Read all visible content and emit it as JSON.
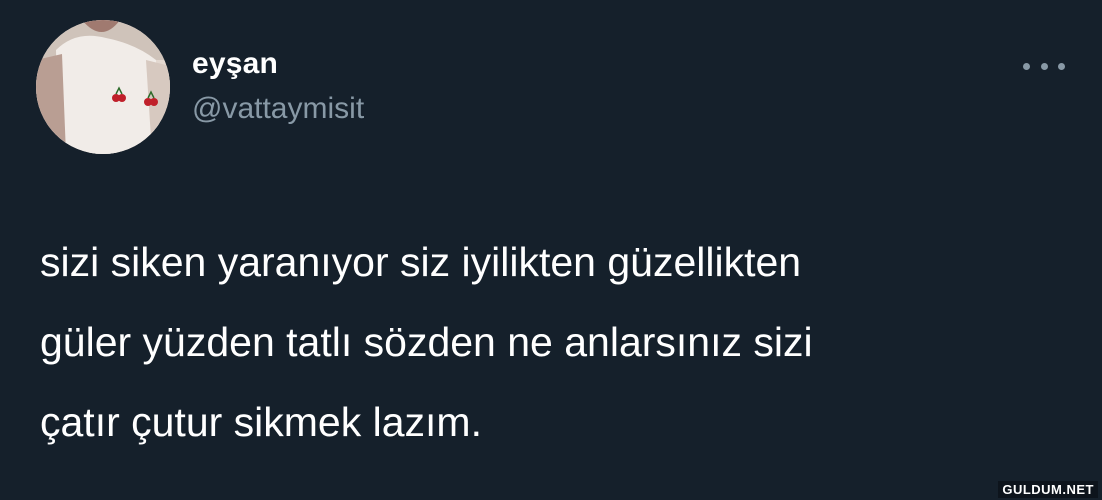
{
  "tweet": {
    "author": {
      "display_name": "eyşan",
      "handle": "@vattaymisit"
    },
    "text": "sizi siken yaranıyor siz iyilikten güzellikten\ngüler yüzden tatlı sözden ne anlarsınız sizi\nçatır çutur sikmek lazım."
  },
  "watermark": "GULDUM.NET",
  "icons": {
    "more": "more-options-icon",
    "avatar": "avatar-image"
  },
  "colors": {
    "background": "#15202b",
    "text": "#ffffff",
    "secondary": "#8899a6"
  }
}
